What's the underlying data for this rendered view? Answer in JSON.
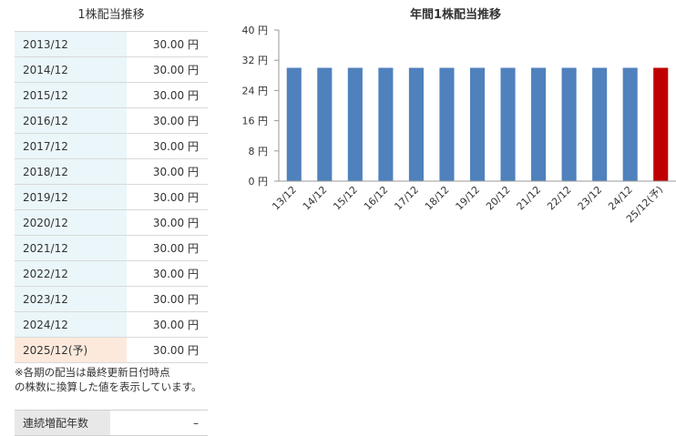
{
  "table": {
    "title": "1株配当推移",
    "rows": [
      {
        "period": "2013/12",
        "value": "30.00 円"
      },
      {
        "period": "2014/12",
        "value": "30.00 円"
      },
      {
        "period": "2015/12",
        "value": "30.00 円"
      },
      {
        "period": "2016/12",
        "value": "30.00 円"
      },
      {
        "period": "2017/12",
        "value": "30.00 円"
      },
      {
        "period": "2018/12",
        "value": "30.00 円"
      },
      {
        "period": "2019/12",
        "value": "30.00 円"
      },
      {
        "period": "2020/12",
        "value": "30.00 円"
      },
      {
        "period": "2021/12",
        "value": "30.00 円"
      },
      {
        "period": "2022/12",
        "value": "30.00 円"
      },
      {
        "period": "2023/12",
        "value": "30.00 円"
      },
      {
        "period": "2024/12",
        "value": "30.00 円"
      },
      {
        "period": "2025/12(予)",
        "value": "30.00 円",
        "forecast": true
      }
    ]
  },
  "note": {
    "line1": "※各期の配当は最終更新日付時点",
    "line2": "の株数に換算した値を表示しています。"
  },
  "streak": {
    "label": "連続増配年数",
    "value": "–"
  },
  "colors": {
    "bar": "#4f81bd",
    "forecast_bar": "#c00000",
    "period_bg": "#eaf6f9",
    "forecast_bg": "#fde9dc"
  },
  "chart_data": {
    "type": "bar",
    "title": "年間1株配当推移",
    "categories": [
      "13/12",
      "14/12",
      "15/12",
      "16/12",
      "17/12",
      "18/12",
      "19/12",
      "20/12",
      "21/12",
      "22/12",
      "23/12",
      "24/12",
      "25/12(予)"
    ],
    "values": [
      30,
      30,
      30,
      30,
      30,
      30,
      30,
      30,
      30,
      30,
      30,
      30,
      30
    ],
    "forecast_index": 12,
    "yticks": [
      "0 円",
      "8 円",
      "16 円",
      "24 円",
      "32 円",
      "40 円"
    ],
    "ytick_values": [
      0,
      8,
      16,
      24,
      32,
      40
    ],
    "ylim": [
      0,
      40
    ],
    "grid": false
  }
}
